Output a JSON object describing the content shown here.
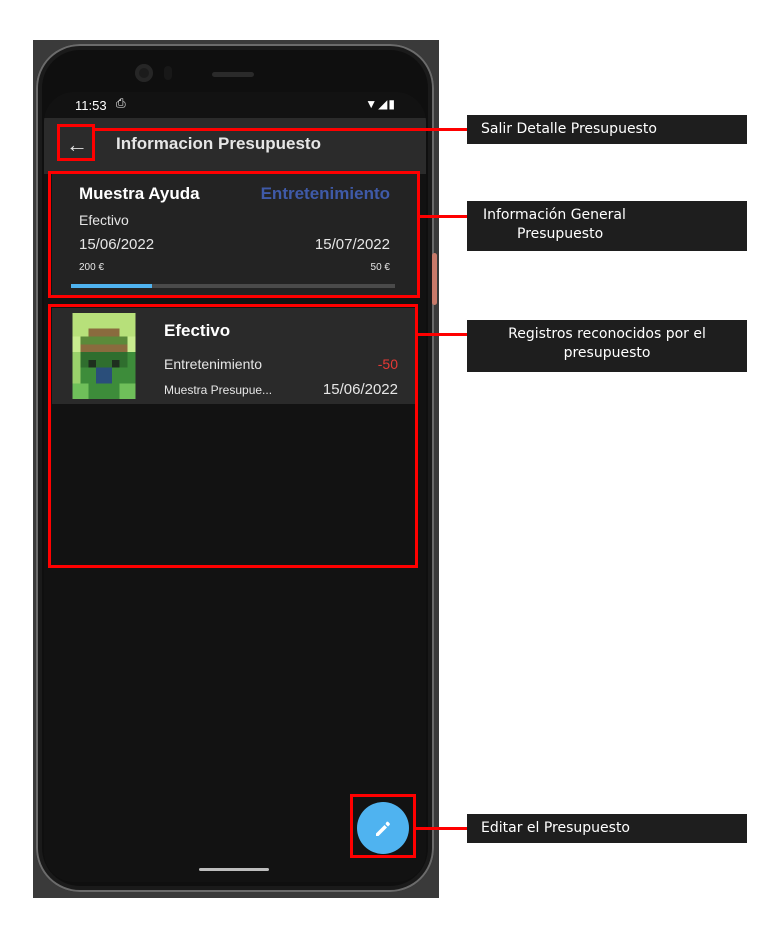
{
  "status_bar": {
    "time": "11:53",
    "sim_icon": "sim-card-icon",
    "icons": "wifi-signal-battery"
  },
  "app_bar": {
    "back_icon": "arrow-left-icon",
    "title": "Informacion Presupuesto"
  },
  "budget": {
    "name": "Muestra Ayuda",
    "category": "Entretenimiento",
    "payment_method": "Efectivo",
    "start_date": "15/06/2022",
    "end_date": "15/07/2022",
    "total": "200 €",
    "remaining": "50 €",
    "progress_fraction": 0.25,
    "category_color": "#3f5aa8",
    "progress_color": "#4fb3f0"
  },
  "records": [
    {
      "title": "Efectivo",
      "category": "Entretenimiento",
      "amount": "-50",
      "description": "Muestra Presupue...",
      "date": "15/06/2022",
      "avatar": "pixel-art-avatar",
      "amount_color": "#e53935"
    }
  ],
  "fab": {
    "icon": "pencil-icon",
    "color": "#4fb3f0"
  },
  "annotations": {
    "exit": "Salir Detalle Presupuesto",
    "general_info_line1": "Información General",
    "general_info_line2": "Presupuesto",
    "records_line1": "Registros reconocidos por el",
    "records_line2": "presupuesto",
    "edit": "Editar el Presupuesto",
    "highlight_color": "#ff0000"
  }
}
